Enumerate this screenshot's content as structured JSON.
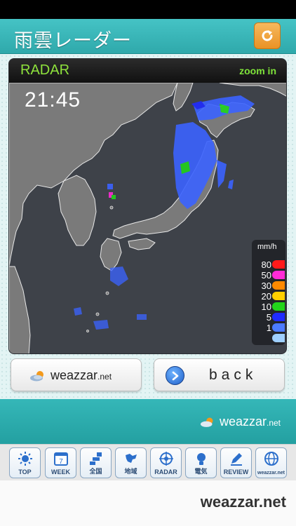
{
  "header": {
    "title": "雨雲レーダー",
    "refresh_icon": "refresh-icon"
  },
  "radar": {
    "label": "RADAR",
    "zoom_label": "zoom in",
    "time": "21:45",
    "legend": {
      "unit": "mm/h",
      "levels": [
        {
          "value": "80",
          "color": "#ff1a1a"
        },
        {
          "value": "50",
          "color": "#ff2ad6"
        },
        {
          "value": "30",
          "color": "#ff8a00"
        },
        {
          "value": "20",
          "color": "#ffd000"
        },
        {
          "value": "10",
          "color": "#22d51b"
        },
        {
          "value": "5",
          "color": "#1f2bff"
        },
        {
          "value": "1",
          "color": "#4b7bff"
        },
        {
          "value": "",
          "color": "#9fd0ff"
        }
      ]
    }
  },
  "buttons": {
    "weazzar_logo": {
      "name": "weazzar",
      "suffix": ".net"
    },
    "back_label": "back"
  },
  "footer": {
    "logo": {
      "name": "weazzar",
      "suffix": ".net"
    }
  },
  "tabs": [
    {
      "label": "TOP",
      "icon": "sun-icon"
    },
    {
      "label": "WEEK",
      "icon": "calendar-icon",
      "badge": "7"
    },
    {
      "label": "全国",
      "icon": "japan-map-icon"
    },
    {
      "label": "地域",
      "icon": "region-icon"
    },
    {
      "label": "RADAR",
      "icon": "radar-icon"
    },
    {
      "label": "電気",
      "icon": "bulb-icon"
    },
    {
      "label": "REVIEW",
      "icon": "pencil-icon"
    },
    {
      "label": "weazzar.net",
      "icon": "globe-icon"
    }
  ],
  "brand": "weazzar.net",
  "colors": {
    "accent": "#2fa9ab",
    "radar_bg": "#3c4047",
    "land": "#7d7d7d",
    "sea": "#3e4249"
  }
}
